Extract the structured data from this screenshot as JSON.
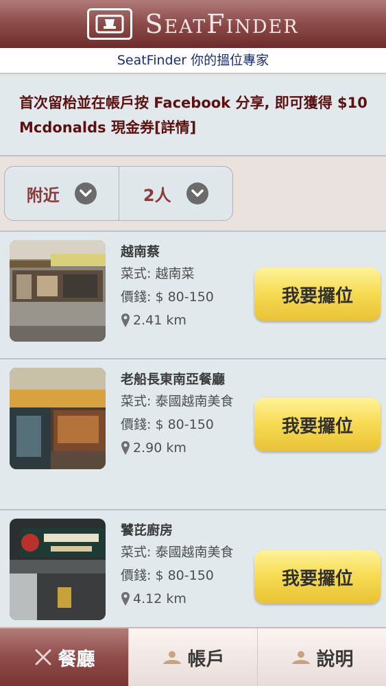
{
  "header": {
    "app_name": "SeatFinder",
    "tagline": "SeatFinder 你的搵位專家"
  },
  "promo": {
    "text": "首次留枱並在帳戶按 Facebook 分享, 即可獲得 $10 Mcdonalds 現金券[詳情]"
  },
  "filters": {
    "location": "附近",
    "party_size": "2人"
  },
  "restaurants": [
    {
      "name": "越南蔡",
      "cuisine": "菜式: 越南菜",
      "price": "價錢: $ 80-150",
      "distance": "2.41 km",
      "book_label": "我要攞位"
    },
    {
      "name": "老船長東南亞餐廳",
      "cuisine": "菜式: 泰國越南美食",
      "price": "價錢: $ 80-150",
      "distance": "2.90 km",
      "book_label": "我要攞位"
    },
    {
      "name": "饕芘廚房",
      "cuisine": "菜式: 泰國越南美食",
      "price": "價錢: $ 80-150",
      "distance": "4.12 km",
      "book_label": "我要攞位"
    }
  ],
  "tabs": [
    {
      "label": "餐廳",
      "icon": "fork-knife-icon",
      "active": true
    },
    {
      "label": "帳戶",
      "icon": "user-icon",
      "active": false
    },
    {
      "label": "說明",
      "icon": "help-icon",
      "active": false
    }
  ],
  "colors": {
    "header": "#8f4f4d",
    "promo_text": "#5d1010",
    "button": "#f7dc55",
    "active_tab": "#8e4c4a"
  }
}
